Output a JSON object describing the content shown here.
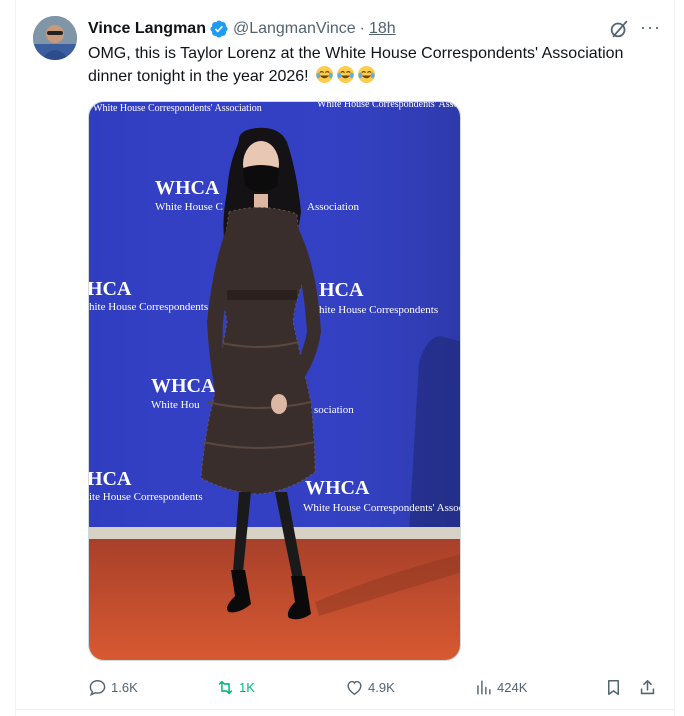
{
  "author": {
    "display_name": "Vince Langman",
    "handle": "@LangmanVince",
    "time": "18h"
  },
  "text": "OMG, this is Taylor Lorenz at the White House Correspondents' Association dinner tonight in the year 2026!",
  "emojis": [
    "face-with-tears-of-joy-emoji",
    "face-with-tears-of-joy-emoji",
    "face-with-tears-of-joy-emoji"
  ],
  "media": {
    "backdrop_logo": "WHCA",
    "backdrop_line1": "White House Correspondents' Association",
    "backdrop_short": "White House C",
    "backdrop_assoc": "Association",
    "backdrop_hite": "hite House Correspondents",
    "backdrop_ite": "ite House Correspondents",
    "backdrop_hca": "HCA",
    "backdrop_whca_partial": "WHCA",
    "backdrop_whou": "White Hou",
    "backdrop_sociation": "sociation",
    "colors": {
      "backdrop": "#3340c4",
      "carpet": "#c6502c"
    }
  },
  "actions": {
    "replies": "1.6K",
    "reposts": "1K",
    "likes": "4.9K",
    "views": "424K"
  },
  "colors": {
    "verified": "#1d9bf0",
    "muted": "#536471",
    "text": "#0f1419",
    "retweet_icon": "#00ba7c"
  }
}
